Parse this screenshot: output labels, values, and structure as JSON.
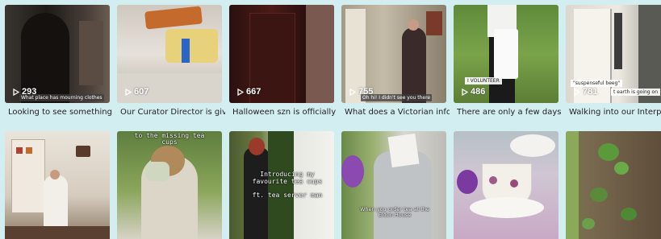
{
  "row1": [
    {
      "views": "293",
      "caption": "Looking to see something...",
      "tag": "What place has mourning clothes"
    },
    {
      "views": "607",
      "caption": "Our Curator Director is giv..."
    },
    {
      "views": "667",
      "caption": "Halloween szn is officially ..."
    },
    {
      "views": "755",
      "caption": "What does a Victorian info...",
      "tag": "Oh hi! I didn't see you there"
    },
    {
      "views": "486",
      "caption": "There are only a few days ...",
      "tag_top": "I VOLUNTEER"
    },
    {
      "views": "781",
      "caption": "Walking into our Interpreti...",
      "tag_top": "\"suspenseful beeg\"",
      "tag_top2": "t earth is going on"
    }
  ],
  "row2": [
    {
      "overlay": ""
    },
    {
      "overlay": "to the missing tea cups"
    },
    {
      "overlay": "Introducing my favourite tea cups\n\nft. tea server man"
    },
    {
      "overlay": "When you order tea at the Eldon House"
    },
    {
      "overlay": ""
    },
    {
      "overlay": ""
    }
  ]
}
